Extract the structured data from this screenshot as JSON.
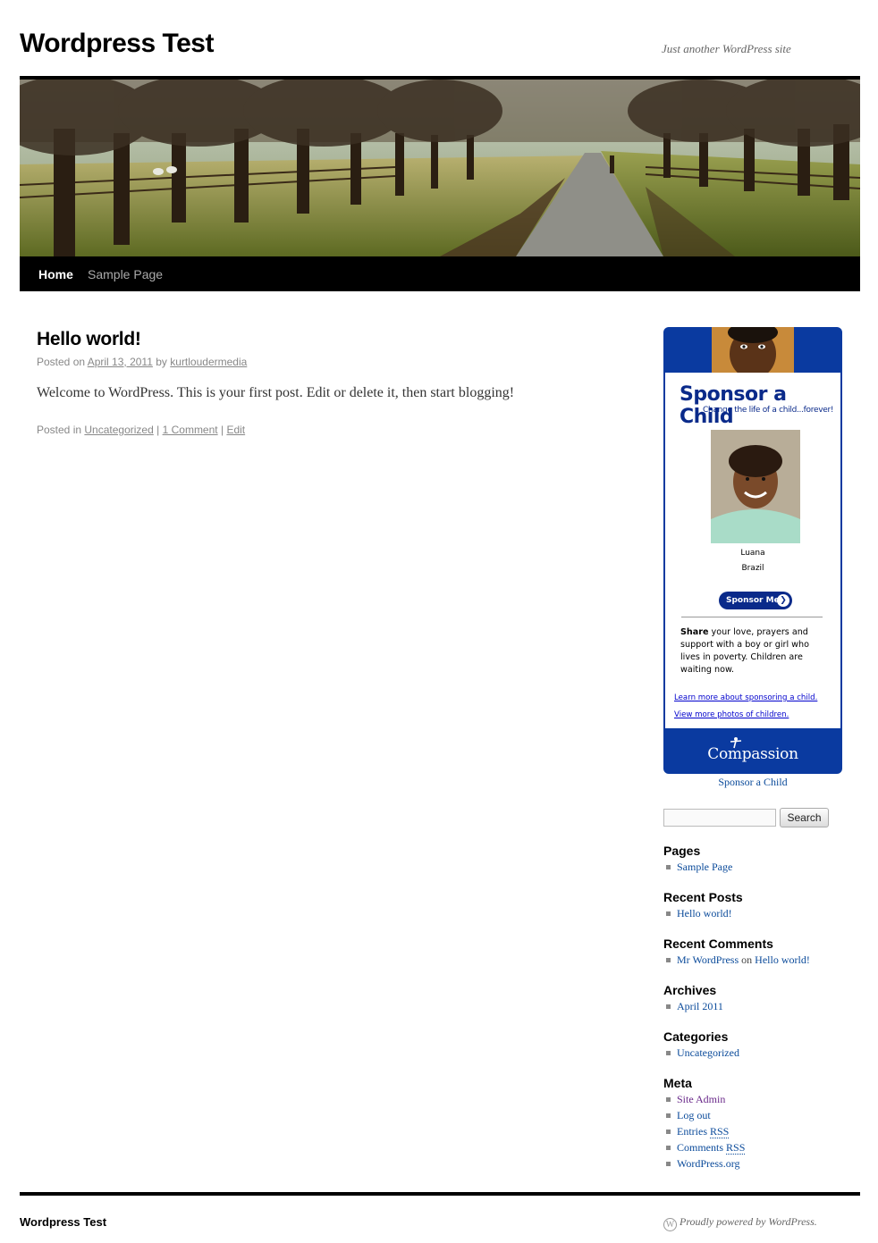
{
  "site": {
    "title": "Wordpress Test",
    "description": "Just another WordPress site"
  },
  "nav": {
    "items": [
      {
        "label": "Home",
        "current": true
      },
      {
        "label": "Sample Page",
        "current": false
      }
    ]
  },
  "post": {
    "title": "Hello world!",
    "meta_prefix": "Posted on",
    "date": "April 13, 2011",
    "by_word": "by",
    "author": "kurtloudermedia",
    "content": "Welcome to WordPress. This is your first post. Edit or delete it, then start blogging!",
    "utility_prefix": "Posted in",
    "category": "Uncategorized",
    "separator": "|",
    "comments": "1 Comment",
    "edit": "Edit"
  },
  "sponsor_widget": {
    "title": "Sponsor a Child",
    "subtitle": "Change the life of a child...forever!",
    "child_name": "Luana",
    "child_country": "Brazil",
    "button_label": "Sponsor Me",
    "share_bold": "Share",
    "share_text": "your love, prayers and support with a boy or girl who lives in poverty. Children are waiting now.",
    "link_learn": "Learn more about sponsoring a child.",
    "link_photos": "View more photos of children.",
    "logo_text": "Compassion",
    "caption": "Sponsor a Child",
    "brand_color": "#0a3aa0"
  },
  "search": {
    "value": "",
    "button_label": "Search"
  },
  "widgets": {
    "pages": {
      "title": "Pages",
      "items": [
        "Sample Page"
      ]
    },
    "recent_posts": {
      "title": "Recent Posts",
      "items": [
        "Hello world!"
      ]
    },
    "recent_comments": {
      "title": "Recent Comments",
      "author": "Mr WordPress",
      "on_word": "on",
      "post": "Hello world!"
    },
    "archives": {
      "title": "Archives",
      "items": [
        "April 2011"
      ]
    },
    "categories": {
      "title": "Categories",
      "items": [
        "Uncategorized"
      ]
    },
    "meta": {
      "title": "Meta",
      "site_admin": "Site Admin",
      "log_out": "Log out",
      "entries_prefix": "Entries",
      "comments_prefix": "Comments",
      "rss": "RSS",
      "wordpress_org": "WordPress.org"
    }
  },
  "footer": {
    "title": "Wordpress Test",
    "powered": "Proudly powered by WordPress."
  }
}
